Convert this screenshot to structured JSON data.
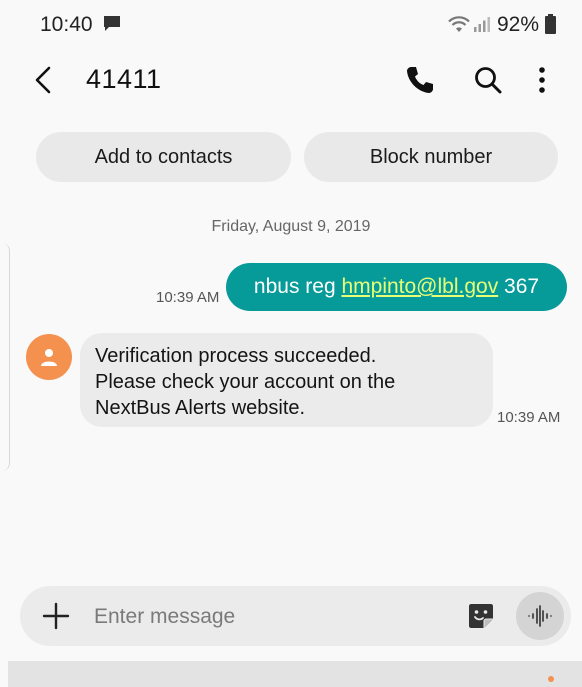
{
  "status_bar": {
    "time": "10:40",
    "battery": "92%",
    "icons": [
      "message-icon",
      "wifi-icon",
      "signal-icon",
      "battery-icon"
    ]
  },
  "app_bar": {
    "title": "41411",
    "icons": [
      "back-icon",
      "phone-icon",
      "search-icon",
      "more-vertical-icon"
    ]
  },
  "actions": {
    "add_to_contacts": "Add to contacts",
    "block_number": "Block number"
  },
  "conversation": {
    "date": "Friday, August 9, 2019",
    "outgoing": {
      "prefix": "nbus reg ",
      "link": "hmpinto@lbl.gov",
      "suffix": " 367",
      "time": "10:39 AM"
    },
    "incoming": {
      "lines": [
        "Verification process succeeded.",
        "Please check your account on the",
        "NextBus Alerts website."
      ],
      "time": "10:39 AM"
    }
  },
  "composer": {
    "placeholder": "Enter message",
    "value": "",
    "icons": [
      "plus-icon",
      "sticker-icon",
      "voice-icon"
    ]
  },
  "colors": {
    "outgoing_bubble": "#069a99",
    "link": "#e6ff74",
    "incoming_bubble": "#ebebeb",
    "avatar": "#f4914f"
  }
}
